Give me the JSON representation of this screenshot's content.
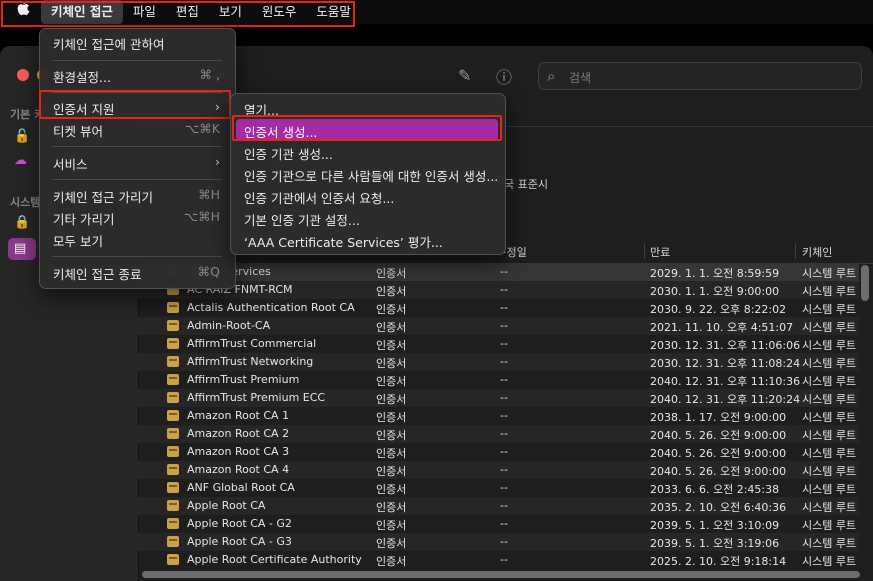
{
  "menubar": {
    "apple_icon": "apple-logo-icon",
    "items": [
      {
        "label": "키체인 접근"
      },
      {
        "label": "파일"
      },
      {
        "label": "편집"
      },
      {
        "label": "보기"
      },
      {
        "label": "윈도우"
      },
      {
        "label": "도움말"
      }
    ]
  },
  "app_menu": {
    "items": [
      {
        "label": "키체인 접근에 관하여",
        "shortcut": ""
      },
      {
        "label": "환경설정...",
        "shortcut": "⌘ ,"
      },
      {
        "label": "인증서 지원",
        "shortcut": ""
      },
      {
        "label": "티켓 뷰어",
        "shortcut": "⌥⌘K"
      },
      {
        "label": "서비스",
        "shortcut": ""
      },
      {
        "label": "키체인 접근 가리기",
        "shortcut": "⌘H"
      },
      {
        "label": "기타 가리기",
        "shortcut": "⌥⌘H"
      },
      {
        "label": "모두 보기",
        "shortcut": ""
      },
      {
        "label": "키체인 접근 종료",
        "shortcut": "⌘Q"
      }
    ]
  },
  "submenu": {
    "items": [
      {
        "label": "열기..."
      },
      {
        "label": "인증서 생성..."
      },
      {
        "label": "인증 기관 생성..."
      },
      {
        "label": "인증 기관으로 다른 사람들에 대한 인증서 생성..."
      },
      {
        "label": "인증 기관에서 인증서 요청..."
      },
      {
        "label": "기본 인증 기관 설정..."
      },
      {
        "label": "‘AAA Certificate Services’ 평가..."
      }
    ]
  },
  "sidebar": {
    "heading1": "기본 키",
    "heading2": "시스템"
  },
  "search": {
    "placeholder": "검색"
  },
  "info": {
    "partial_text": "국 표준시"
  },
  "table": {
    "columns": {
      "c3": "만료 예정일",
      "c3_partial": "·정일",
      "c4": "만료",
      "c5": "키체인"
    },
    "rows": [
      {
        "name": "ificate Services",
        "kind": "인증서",
        "date": "--",
        "expires": "2029. 1. 1. 오전 8:59:59",
        "keychain": "시스템 루트"
      },
      {
        "name": "AC RAIZ FNMT-RCM",
        "kind": "인증서",
        "date": "--",
        "expires": "2030. 1. 1. 오전 9:00:00",
        "keychain": "시스템 루트"
      },
      {
        "name": "Actalis Authentication Root CA",
        "kind": "인증서",
        "date": "--",
        "expires": "2030. 9. 22. 오후 8:22:02",
        "keychain": "시스템 루트"
      },
      {
        "name": "Admin-Root-CA",
        "kind": "인증서",
        "date": "--",
        "expires": "2021. 11. 10. 오후 4:51:07",
        "keychain": "시스템 루트"
      },
      {
        "name": "AffirmTrust Commercial",
        "kind": "인증서",
        "date": "--",
        "expires": "2030. 12. 31. 오후 11:06:06",
        "keychain": "시스템 루트"
      },
      {
        "name": "AffirmTrust Networking",
        "kind": "인증서",
        "date": "--",
        "expires": "2030. 12. 31. 오후 11:08:24",
        "keychain": "시스템 루트"
      },
      {
        "name": "AffirmTrust Premium",
        "kind": "인증서",
        "date": "--",
        "expires": "2040. 12. 31. 오후 11:10:36",
        "keychain": "시스템 루트"
      },
      {
        "name": "AffirmTrust Premium ECC",
        "kind": "인증서",
        "date": "--",
        "expires": "2040. 12. 31. 오후 11:20:24",
        "keychain": "시스템 루트"
      },
      {
        "name": "Amazon Root CA 1",
        "kind": "인증서",
        "date": "--",
        "expires": "2038. 1. 17. 오전 9:00:00",
        "keychain": "시스템 루트"
      },
      {
        "name": "Amazon Root CA 2",
        "kind": "인증서",
        "date": "--",
        "expires": "2040. 5. 26. 오전 9:00:00",
        "keychain": "시스템 루트"
      },
      {
        "name": "Amazon Root CA 3",
        "kind": "인증서",
        "date": "--",
        "expires": "2040. 5. 26. 오전 9:00:00",
        "keychain": "시스템 루트"
      },
      {
        "name": "Amazon Root CA 4",
        "kind": "인증서",
        "date": "--",
        "expires": "2040. 5. 26. 오전 9:00:00",
        "keychain": "시스템 루트"
      },
      {
        "name": "ANF Global Root CA",
        "kind": "인증서",
        "date": "--",
        "expires": "2033. 6. 6. 오전 2:45:38",
        "keychain": "시스템 루트"
      },
      {
        "name": "Apple Root CA",
        "kind": "인증서",
        "date": "--",
        "expires": "2035. 2. 10. 오전 6:40:36",
        "keychain": "시스템 루트"
      },
      {
        "name": "Apple Root CA - G2",
        "kind": "인증서",
        "date": "--",
        "expires": "2039. 5. 1. 오전 3:10:09",
        "keychain": "시스템 루트"
      },
      {
        "name": "Apple Root CA - G3",
        "kind": "인증서",
        "date": "--",
        "expires": "2039. 5. 1. 오전 3:19:06",
        "keychain": "시스템 루트"
      },
      {
        "name": "Apple Root Certificate Authority",
        "kind": "인증서",
        "date": "--",
        "expires": "2025. 2. 10. 오전 9:18:14",
        "keychain": "시스템 루트"
      }
    ]
  },
  "colors": {
    "accent": "#a32ba3",
    "highlight_border": "#e8231b"
  }
}
